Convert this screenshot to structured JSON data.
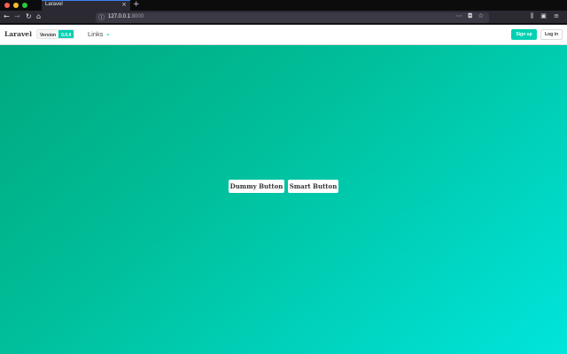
{
  "browser": {
    "tab_title": "Laravel",
    "tab_close_glyph": "×",
    "new_tab_glyph": "+",
    "url_host": "127.0.0.1",
    "url_port": ":8000",
    "back_icon": "back-arrow-icon",
    "forward_icon": "forward-arrow-icon",
    "reload_icon": "reload-icon",
    "home_icon": "home-icon",
    "traffic_colors": [
      "#ff5f57",
      "#febc2e",
      "#28c840"
    ]
  },
  "navbar": {
    "brand": "Laravel",
    "version_label": "Version",
    "version_value": "0.0.4",
    "links_label": "Links",
    "signup_label": "Sign up",
    "login_label": "Log in",
    "accent_color": "#00d1b2"
  },
  "hero": {
    "dummy_button": "Dummy Button",
    "smart_button": "Smart Button",
    "gradient_start": "#00a87e",
    "gradient_end": "#00e5dc"
  }
}
